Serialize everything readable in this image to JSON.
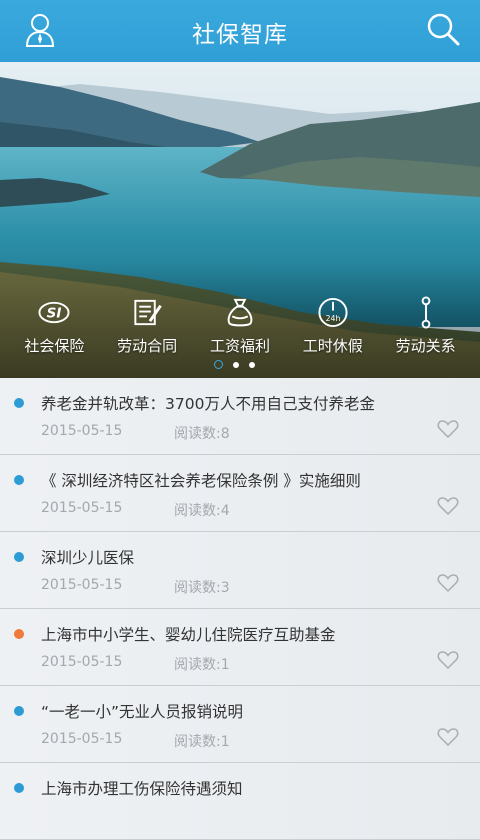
{
  "header": {
    "title": "社保智库",
    "user_icon": "user-icon",
    "search_icon": "search-icon",
    "color": "#35a4da"
  },
  "banner": {
    "shortcuts": [
      {
        "label": "社会保险",
        "icon": "social-insurance-icon"
      },
      {
        "label": "劳动合同",
        "icon": "contract-icon"
      },
      {
        "label": "工资福利",
        "icon": "money-bag-icon"
      },
      {
        "label": "工时休假",
        "icon": "clock-24h-icon"
      },
      {
        "label": "劳动关系",
        "icon": "relation-icon"
      }
    ],
    "page_count": 3,
    "active_page": 1
  },
  "articles": [
    {
      "title": "养老金并轨改革：3700万人不用自己支付养老金",
      "date": "2015-05-15",
      "reads": "阅读数:8",
      "bullet_color": "#2d9bd4"
    },
    {
      "title": "《 深圳经济特区社会养老保险条例 》实施细则",
      "date": "2015-05-15",
      "reads": "阅读数:4",
      "bullet_color": "#2d9bd4"
    },
    {
      "title": "深圳少儿医保",
      "date": "2015-05-15",
      "reads": "阅读数:3",
      "bullet_color": "#2d9bd4"
    },
    {
      "title": "上海市中小学生、婴幼儿住院医疗互助基金",
      "date": "2015-05-15",
      "reads": "阅读数:1",
      "bullet_color": "#ee7a3c"
    },
    {
      "title": "“一老一小”无业人员报销说明",
      "date": "2015-05-15",
      "reads": "阅读数:1",
      "bullet_color": "#2d9bd4"
    },
    {
      "title": "上海市办理工伤保险待遇须知",
      "date": "",
      "reads": "",
      "bullet_color": "#2d9bd4"
    }
  ]
}
